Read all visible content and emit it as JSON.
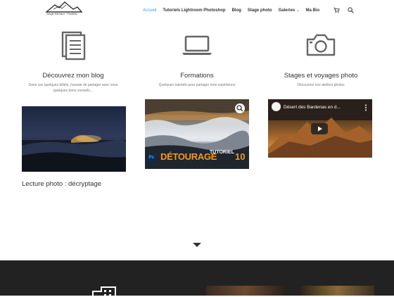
{
  "header": {
    "logo_text": "Serge Richard · Portfolio",
    "nav": [
      {
        "label": "Accueil",
        "active": true,
        "has_dropdown": false
      },
      {
        "label": "Tutoriels Lightroom Photoshop",
        "active": false,
        "has_dropdown": false
      },
      {
        "label": "Blog",
        "active": false,
        "has_dropdown": false
      },
      {
        "label": "Stage photo",
        "active": false,
        "has_dropdown": false
      },
      {
        "label": "Galeries",
        "active": false,
        "has_dropdown": true
      },
      {
        "label": "Ma Bio",
        "active": false,
        "has_dropdown": false
      }
    ],
    "cart_icon": "cart-icon",
    "search_icon": "search-icon"
  },
  "columns": [
    {
      "icon": "document-icon",
      "title": "Découvrez mon blog",
      "text": "Dans ces quelques billets, j'essaie de partager avec vous quelques bons conseils..."
    },
    {
      "icon": "laptop-icon",
      "title": "Formations",
      "text": "Quelques tutoriels pour partager mon expérience"
    },
    {
      "icon": "camera-icon",
      "title": "Stages et voyages photo",
      "text": "Découvrez nos ateliers photos"
    }
  ],
  "blog_card": {
    "caption": "Lecture photo : décryptage"
  },
  "tutorial_card": {
    "ps_label": "Ps",
    "title_left": "DÉTOURAGE",
    "title_mid": "TUTORIEL",
    "number": "10",
    "zoom_icon": "zoom-icon"
  },
  "video_card": {
    "title": "Désert des Bardenas en d...",
    "play_icon": "play-icon",
    "menu_icon": "more-vert-icon"
  },
  "colors": {
    "accent": "#2ea3f2",
    "footer_bg": "#222222",
    "tutorial_orange": "#f29a24"
  }
}
